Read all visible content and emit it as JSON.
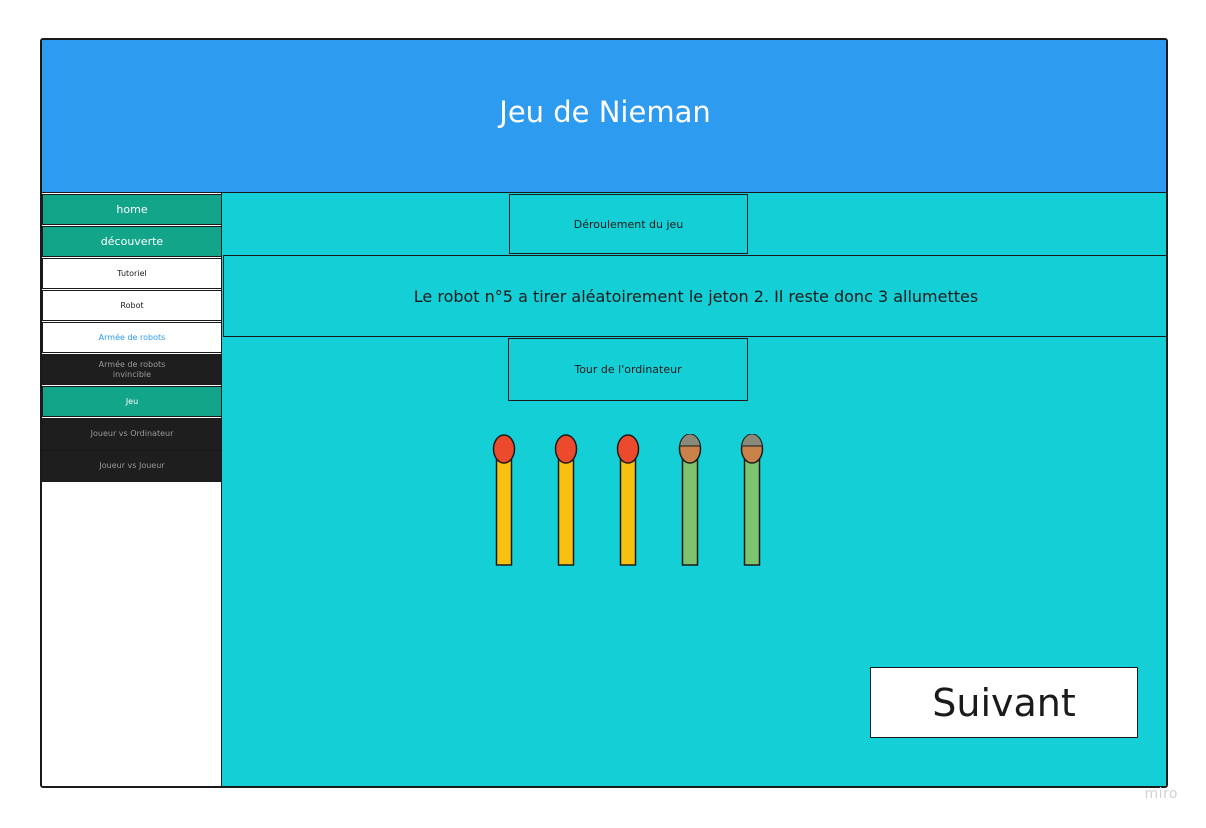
{
  "header": {
    "title": "Jeu de Nieman",
    "color": "#2d9bf0"
  },
  "sidebar": {
    "items": [
      {
        "label": "home",
        "style": "green"
      },
      {
        "label": "découverte",
        "style": "green"
      },
      {
        "label": "Tutoriel",
        "style": "white"
      },
      {
        "label": "Robot",
        "style": "white"
      },
      {
        "label": "Armée de robots",
        "style": "white-blue"
      },
      {
        "label": "Armée de robots invincible",
        "style": "dark"
      },
      {
        "label": "Jeu",
        "style": "green"
      },
      {
        "label": "Joueur vs Ordinateur",
        "style": "dark"
      },
      {
        "label": "Joueur vs Joueur",
        "style": "dark"
      }
    ]
  },
  "main": {
    "section_title": "Déroulement du jeu",
    "message": "Le robot n°5 a tirer aléatoirement le jeton 2. Il reste donc 3 allumettes",
    "turn_label": "Tour de l'ordinateur",
    "next_button": "Suivant",
    "matches": [
      {
        "state": "remaining",
        "icon": "match-icon"
      },
      {
        "state": "remaining",
        "icon": "match-icon"
      },
      {
        "state": "remaining",
        "icon": "match-icon"
      },
      {
        "state": "removed",
        "icon": "burnt-match-icon"
      },
      {
        "state": "removed",
        "icon": "burnt-match-icon"
      }
    ],
    "colors": {
      "background": "#14cfd6",
      "match_remaining_stick": "#f7c10f",
      "match_remaining_head": "#ec4a2c",
      "match_removed_stick": "#7ec36d",
      "match_removed_head": "#c8824a"
    }
  },
  "watermark": "miro"
}
